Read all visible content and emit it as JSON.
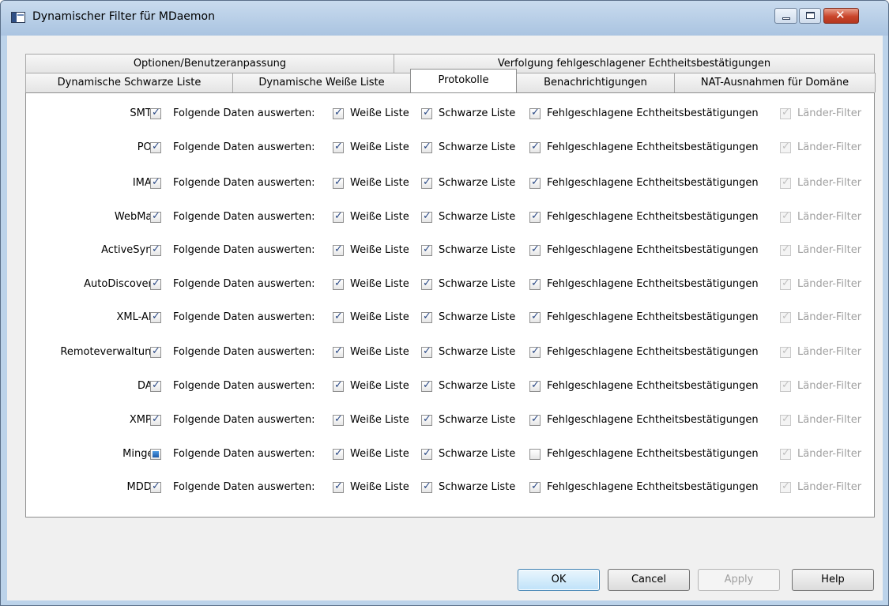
{
  "window": {
    "title": "Dynamischer Filter für MDaemon"
  },
  "tabs": {
    "back": [
      {
        "label": "Optionen/Benutzeranpassung"
      },
      {
        "label": "Verfolgung fehlgeschlagener Echtheitsbestätigungen"
      }
    ],
    "front": [
      {
        "label": "Dynamische Schwarze Liste"
      },
      {
        "label": "Dynamische Weiße Liste"
      },
      {
        "label": "Protokolle",
        "active": true
      },
      {
        "label": "Benachrichtigungen"
      },
      {
        "label": "NAT-Ausnahmen für Domäne"
      }
    ]
  },
  "evaluate_label": "Folgende Daten auswerten:",
  "option_labels": {
    "whitelist": "Weiße Liste",
    "blacklist": "Schwarze Liste",
    "failed_auth": "Fehlgeschlagene Echtheitsbestätigungen",
    "country": "Länder-Filter"
  },
  "protocols": [
    {
      "name": "SMTP:",
      "state": "checked",
      "whitelist": true,
      "blacklist": true,
      "failed_auth": true,
      "country": true
    },
    {
      "name": "POP:",
      "state": "checked",
      "whitelist": true,
      "blacklist": true,
      "failed_auth": true,
      "country": true
    },
    {
      "name": "IMAP:",
      "state": "checked",
      "whitelist": true,
      "blacklist": true,
      "failed_auth": true,
      "country": true
    },
    {
      "name": "WebMail:",
      "state": "checked",
      "whitelist": true,
      "blacklist": true,
      "failed_auth": true,
      "country": true
    },
    {
      "name": "ActiveSync:",
      "state": "checked",
      "whitelist": true,
      "blacklist": true,
      "failed_auth": true,
      "country": true
    },
    {
      "name": "AutoDiscovery:",
      "state": "checked",
      "whitelist": true,
      "blacklist": true,
      "failed_auth": true,
      "country": true
    },
    {
      "name": "XML-API:",
      "state": "checked",
      "whitelist": true,
      "blacklist": true,
      "failed_auth": true,
      "country": true
    },
    {
      "name": "Remoteverwaltung:",
      "state": "checked",
      "whitelist": true,
      "blacklist": true,
      "failed_auth": true,
      "country": true
    },
    {
      "name": "DAV:",
      "state": "checked",
      "whitelist": true,
      "blacklist": true,
      "failed_auth": true,
      "country": true
    },
    {
      "name": "XMPP:",
      "state": "checked",
      "whitelist": true,
      "blacklist": true,
      "failed_auth": true,
      "country": true
    },
    {
      "name": "Minger:",
      "state": "partial",
      "whitelist": true,
      "blacklist": true,
      "failed_auth": false,
      "country": true
    },
    {
      "name": "MDDP:",
      "state": "checked",
      "whitelist": true,
      "blacklist": true,
      "failed_auth": true,
      "country": true
    }
  ],
  "buttons": {
    "ok": "OK",
    "cancel": "Cancel",
    "apply": "Apply",
    "help": "Help"
  }
}
